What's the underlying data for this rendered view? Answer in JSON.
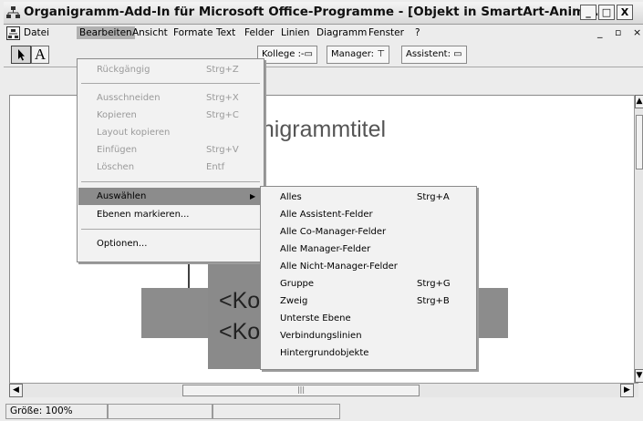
{
  "titlebar": {
    "title": "Organigramm-Add-In für Microsoft Office-Programme - [Objekt in SmartArt-Anim...",
    "btn_minimize": "_",
    "btn_maximize": "□",
    "btn_close": "X"
  },
  "menubar": {
    "items": [
      "Datei",
      "Bearbeiten",
      "Ansicht",
      "Formate",
      "Text",
      "Felder",
      "Linien",
      "Diagramm",
      "Fenster",
      "?"
    ],
    "mdi_minimize": "_",
    "mdi_restore": "▫",
    "mdi_close": "×"
  },
  "toolbar": {
    "text_tool": "A",
    "kollege": "Kollege :-▭",
    "manager": "Manager: ⊤",
    "assistent": "Assistent: ▭"
  },
  "chart": {
    "title": "anigrammtitel",
    "box1": "<Ko",
    "box2": "<Ko"
  },
  "edit_menu": {
    "items": [
      {
        "label": "Rückgängig",
        "shortcut": "Strg+Z",
        "disabled": true
      },
      {
        "label": "Ausschneiden",
        "shortcut": "Strg+X",
        "disabled": true
      },
      {
        "label": "Kopieren",
        "shortcut": "Strg+C",
        "disabled": true
      },
      {
        "label": "Layout kopieren",
        "shortcut": "",
        "disabled": true
      },
      {
        "label": "Einfügen",
        "shortcut": "Strg+V",
        "disabled": true
      },
      {
        "label": "Löschen",
        "shortcut": "Entf",
        "disabled": true
      },
      {
        "label": "Auswählen",
        "shortcut": "",
        "disabled": false,
        "highlighted": true,
        "submenu": true
      },
      {
        "label": "Ebenen markieren...",
        "shortcut": "",
        "disabled": false
      },
      {
        "label": "Optionen...",
        "shortcut": "",
        "disabled": false
      }
    ]
  },
  "select_submenu": {
    "items": [
      {
        "label": "Alles",
        "shortcut": "Strg+A"
      },
      {
        "label": "Alle Assistent-Felder",
        "shortcut": ""
      },
      {
        "label": "Alle Co-Manager-Felder",
        "shortcut": ""
      },
      {
        "label": "Alle Manager-Felder",
        "shortcut": ""
      },
      {
        "label": "Alle Nicht-Manager-Felder",
        "shortcut": ""
      },
      {
        "label": "Gruppe",
        "shortcut": "Strg+G"
      },
      {
        "label": "Zweig",
        "shortcut": "Strg+B"
      },
      {
        "label": "Unterste Ebene",
        "shortcut": ""
      },
      {
        "label": "Verbindungslinien",
        "shortcut": ""
      },
      {
        "label": "Hintergrundobjekte",
        "shortcut": ""
      }
    ]
  },
  "scrollbar": {
    "thumb_grip": "|||"
  },
  "statusbar": {
    "size": "Größe: 100%"
  },
  "colors": {
    "highlight": "#8c8c8c",
    "disabled_text": "#9a9a9a",
    "menu_bg": "#f2f2f2"
  }
}
